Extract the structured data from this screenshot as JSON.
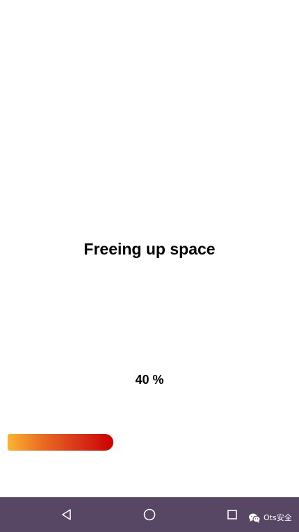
{
  "main": {
    "title": "Freeing up space",
    "percent_label": "40 %",
    "progress": 0.4,
    "progress_gradient": [
      "#fbb42f",
      "#e96a22",
      "#d8351b",
      "#cc0000"
    ]
  },
  "navbar": {
    "background": "#574765",
    "buttons": [
      {
        "name": "back",
        "icon": "triangle-back-icon"
      },
      {
        "name": "home",
        "icon": "circle-home-icon"
      },
      {
        "name": "recent-apps",
        "icon": "square-recents-icon"
      }
    ],
    "watermark": {
      "icon": "wechat-icon",
      "text": "Ots安全"
    }
  }
}
